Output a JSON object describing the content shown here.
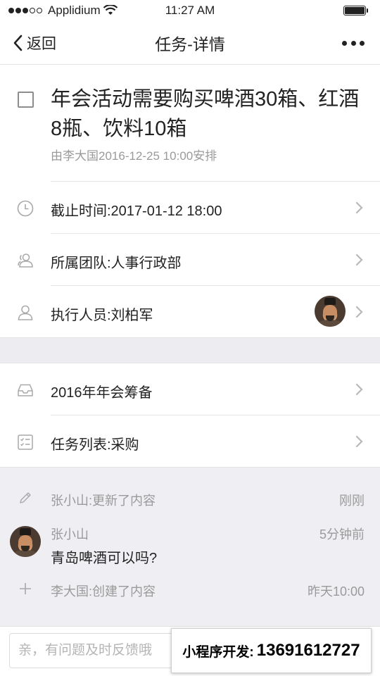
{
  "status_bar": {
    "carrier": "Applidium",
    "time": "11:27 AM"
  },
  "nav": {
    "back_label": "返回",
    "title": "任务-详情"
  },
  "task": {
    "title": "年会活动需要购买啤酒30箱、红酒8瓶、饮料10箱",
    "subtitle": "由李大国2016-12-25 10:00安排"
  },
  "details": [
    {
      "icon": "clock-icon",
      "label": "截止时间:2017-01-12 18:00"
    },
    {
      "icon": "team-icon",
      "label": "所属团队:人事行政部"
    },
    {
      "icon": "person-icon",
      "label": "执行人员:刘柏军"
    }
  ],
  "groups": [
    {
      "icon": "inbox-icon",
      "label": "2016年年会筹备"
    },
    {
      "icon": "checklist-icon",
      "label": "任务列表:采购"
    }
  ],
  "activity": [
    {
      "type": "update",
      "icon": "pencil-icon",
      "text": "张小山:更新了内容",
      "time": "刚刚"
    },
    {
      "type": "comment",
      "author": "张小山",
      "message": "青岛啤酒可以吗?",
      "time": "5分钟前"
    },
    {
      "type": "create",
      "icon": "plus-icon",
      "text": "李大国:创建了内容",
      "time": "昨天10:00"
    }
  ],
  "comment_input": {
    "placeholder": "亲，有问题及时反馈哦"
  },
  "promo": {
    "label": "小程序开发:",
    "phone": "13691612727"
  }
}
